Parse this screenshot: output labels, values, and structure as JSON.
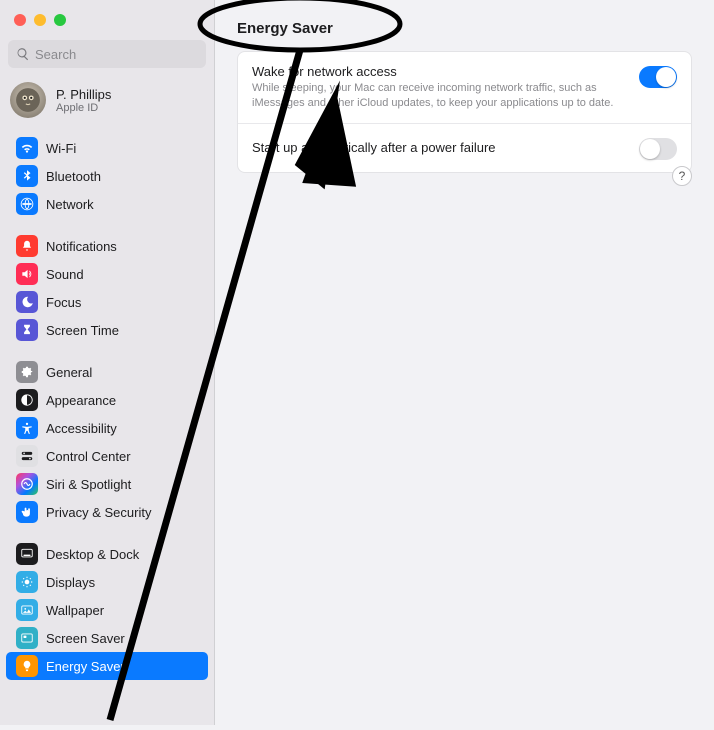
{
  "search": {
    "placeholder": "Search"
  },
  "account": {
    "name": "P. Phillips",
    "sub": "Apple ID"
  },
  "sidebar": {
    "groups": [
      {
        "items": [
          {
            "label": "Wi-Fi",
            "icon": "wifi-icon",
            "bg": "bg-blue"
          },
          {
            "label": "Bluetooth",
            "icon": "bluetooth-icon",
            "bg": "bg-blue"
          },
          {
            "label": "Network",
            "icon": "network-icon",
            "bg": "bg-blue"
          }
        ]
      },
      {
        "items": [
          {
            "label": "Notifications",
            "icon": "bell-icon",
            "bg": "bg-red"
          },
          {
            "label": "Sound",
            "icon": "sound-icon",
            "bg": "bg-pink"
          },
          {
            "label": "Focus",
            "icon": "moon-icon",
            "bg": "bg-indigo"
          },
          {
            "label": "Screen Time",
            "icon": "hourglass-icon",
            "bg": "bg-indigo"
          }
        ]
      },
      {
        "items": [
          {
            "label": "General",
            "icon": "gear-icon",
            "bg": "bg-gray"
          },
          {
            "label": "Appearance",
            "icon": "appearance-icon",
            "bg": "bg-black"
          },
          {
            "label": "Accessibility",
            "icon": "accessibility-icon",
            "bg": "bg-blue"
          },
          {
            "label": "Control Center",
            "icon": "switches-icon",
            "bg": "light"
          },
          {
            "label": "Siri & Spotlight",
            "icon": "siri-icon",
            "bg": "gradient"
          },
          {
            "label": "Privacy & Security",
            "icon": "hand-icon",
            "bg": "bg-blue"
          }
        ]
      },
      {
        "items": [
          {
            "label": "Desktop & Dock",
            "icon": "dock-icon",
            "bg": "bg-black"
          },
          {
            "label": "Displays",
            "icon": "displays-icon",
            "bg": "bg-cyan"
          },
          {
            "label": "Wallpaper",
            "icon": "wallpaper-icon",
            "bg": "bg-cyan"
          },
          {
            "label": "Screen Saver",
            "icon": "screensaver-icon",
            "bg": "bg-teal"
          },
          {
            "label": "Energy Saver",
            "icon": "bulb-icon",
            "bg": "bg-orange",
            "selected": true
          }
        ]
      }
    ]
  },
  "page": {
    "title": "Energy Saver",
    "rows": [
      {
        "title": "Wake for network access",
        "desc": "While sleeping, your Mac can receive incoming network traffic, such as iMessages and other iCloud updates, to keep your applications up to date.",
        "on": true
      },
      {
        "title": "Start up automatically after a power failure",
        "desc": "",
        "on": false
      }
    ]
  },
  "help": "?"
}
